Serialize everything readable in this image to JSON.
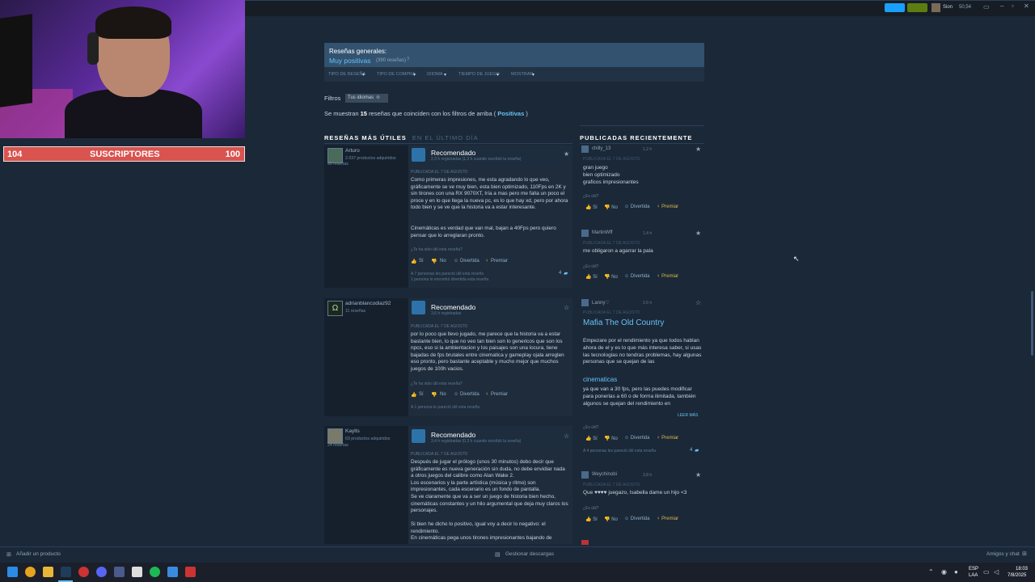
{
  "topbar": {
    "user": "Sion",
    "balance": "50,54"
  },
  "webcam": {
    "sub_count": "104",
    "sub_label": "SUSCRIPTORES",
    "sub_goal": "100"
  },
  "general": {
    "label": "Reseñas generales:",
    "rating": "Muy positivas",
    "count": "(390 reseñas)"
  },
  "filters": [
    "TIPO DE RESEÑA",
    "TIPO DE COMPRA",
    "IDIOMA",
    "TIEMPO DE JUEGO",
    "MOSTRAR"
  ],
  "filters_label": "Filtros",
  "filter_chip": "Tus idiomas",
  "showing": {
    "pre": "Se muestran",
    "count": "15",
    "mid": "reseñas que coinciden con los filtros de arriba (",
    "filter": "Positivas",
    "post": ")"
  },
  "sections": {
    "useful": "RESEÑAS MÁS ÚTILES",
    "useful_period": "EN EL ÚLTIMO DÍA",
    "recent": "PUBLICADAS RECIENTEMENTE"
  },
  "common": {
    "recommended": "Recomendado",
    "helpful_q": "¿Te ha sido útil esta reseña?",
    "yes": "Sí",
    "no": "No",
    "funny": "Divertida",
    "award": "Premiar",
    "was_helpful": "¿Es útil?",
    "read_more": "LEER MÁS"
  },
  "reviews": [
    {
      "user": "Arturo",
      "products": "2.037 productos adquiridos",
      "reviews": "90 reseñas",
      "hours": "2,3 h registradas (1,3 h cuando escribió la reseña)",
      "posted": "PUBLICADA EL 7 DE AGOSTO",
      "text": "Como primeras impresiones, me esta agradando lo que veo, gráficamente se ve muy bien, esta bien optimizado, 110Fps en 2K y sin tirones con una RX 9070XT, Iría a mas pero me falta un poco el proce y en lo que llega la nueva pc, es lo que hay xd, pero por ahora todo bien y se ve que la historia va a estar interesante.",
      "text2": "Cinemáticas es verdad que van mal, bajan a 40Fps pero quiero pensar que lo arreglaran pronto.",
      "found": "A 7 personas les pareció útil esta reseña",
      "found2": "1 persona lo encontró divertida esta reseña",
      "comments": "4"
    },
    {
      "user": "adrianblancodiaz92",
      "reviews": "11 reseñas",
      "hours": "3,6 h registradas",
      "posted": "PUBLICADA EL 7 DE AGOSTO",
      "text": "por lo poco que llevo jugado, me parece que la historia va a estar bastante bien, lo que no veo tan bien son lo genericos que son los npcs, eso si la ambientacion y los paisajes son una locura, tiene bajadas de fps brutales entre cinematica y gameplay ojala arreglen eso pronto, pero bastante aceptable y mucho mejor que muchos juegos de 100h vacios.",
      "found": "A 1 persona le pareció útil esta reseña"
    },
    {
      "user": "Kaylts",
      "products": "63 productos adquiridos",
      "reviews": "24 reseñas",
      "hours": "3,4 h registradas (0,3 h cuando escribió la reseña)",
      "posted": "PUBLICADA EL 7 DE AGOSTO",
      "text": "Después de jugar el prólogo (unos 30 minutos) debo decir que gráficamente es nueva generación sin duda, no debe envidiar nada a otros juegos del calibre como Alan Wake 2.\nLos escenarios y la parte artística (música y ritmo) son impresionantes, cada escenario es un fondo de pantalla.\nSe ve claramente que va a ser un juego de historia bien hecho, cinemáticas constantes y un hilo argumental que deja muy claros los personajes.",
      "text2": "Si bien he dicho lo positivo, igual voy a decir lo negativo: el rendimiento.\nEn cinemáticas pega unos tirones impresionantes bajando de"
    }
  ],
  "recent": [
    {
      "user": "chilly_13",
      "time": "1,2 h",
      "posted": "PUBLICADA EL 7 DE AGOSTO",
      "text": "gran juego\nbien optimizado\ngraficos impresionantes"
    },
    {
      "user": "MartinWff",
      "time": "1,4 h",
      "posted": "PUBLICADA EL 7 DE AGOSTO",
      "text": "me obligaron a agarrar la pala"
    },
    {
      "user": "Lanny♡",
      "time": "2,6 h",
      "posted": "PUBLICADA EL 7 DE AGOSTO",
      "title": "Mafia The Old Country",
      "text": "Empezare por el rendimiento ya que todos hablan ahora de el y es lo que más interesa saber, si usas las tecnologias no tendras problemas, hay algunas personas que se quejan de las",
      "subhead": "cinematicas",
      "text2": "ya que van a 30 fps, pero las puedes modificar para ponerlas a 60 o de forma ilimitada, también algunos se quejan del rendimiento en",
      "found": "A 4 personas les pareció útil esta reseña",
      "comments": "4"
    },
    {
      "user": "Weychinobi",
      "time": "3,8 h",
      "posted": "PUBLICADA EL 7 DE AGOSTO",
      "text": "Que ♥♥♥♥ juegazo, Isabella dame un hijo <3"
    }
  ],
  "bottom": {
    "add_product": "Añadir un producto",
    "downloads": "Gestionar descargas",
    "friends": "Amigos y chat"
  },
  "taskbar": {
    "lang": "ESP",
    "region": "LAA",
    "time": "18:03",
    "date": "7/8/2025"
  }
}
